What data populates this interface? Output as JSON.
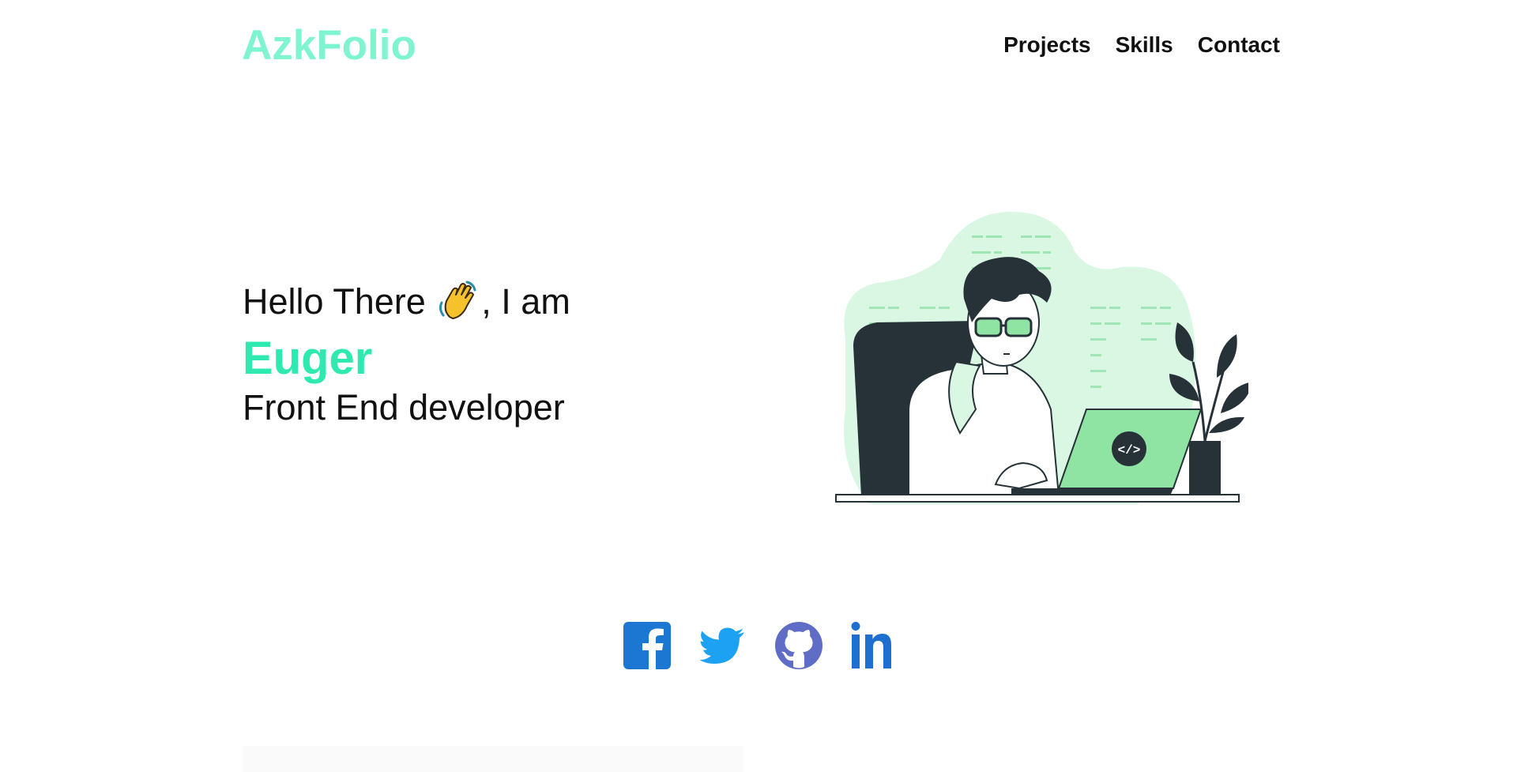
{
  "header": {
    "logo": "AzkFolio",
    "nav": [
      {
        "label": "Projects"
      },
      {
        "label": "Skills"
      },
      {
        "label": "Contact"
      }
    ]
  },
  "hero": {
    "greeting_before": "Hello There ",
    "greeting_after": ", I am",
    "wave_icon": "waving-hand-icon",
    "name": "Euger",
    "role": "Front End developer",
    "illustration": "developer-at-laptop-illustration"
  },
  "socials": [
    {
      "icon": "facebook-icon",
      "color": "#1b77d2"
    },
    {
      "icon": "twitter-icon",
      "color": "#1da1f2"
    },
    {
      "icon": "github-icon",
      "color": "#5f6dc6"
    },
    {
      "icon": "linkedin-icon",
      "color": "#1e6fd0"
    }
  ],
  "colors": {
    "logo": "#7ff5cf",
    "name": "#2eeab0",
    "illustration_green": "#8fe3a3",
    "illustration_bg": "#d9f7e2",
    "dark": "#263238"
  }
}
